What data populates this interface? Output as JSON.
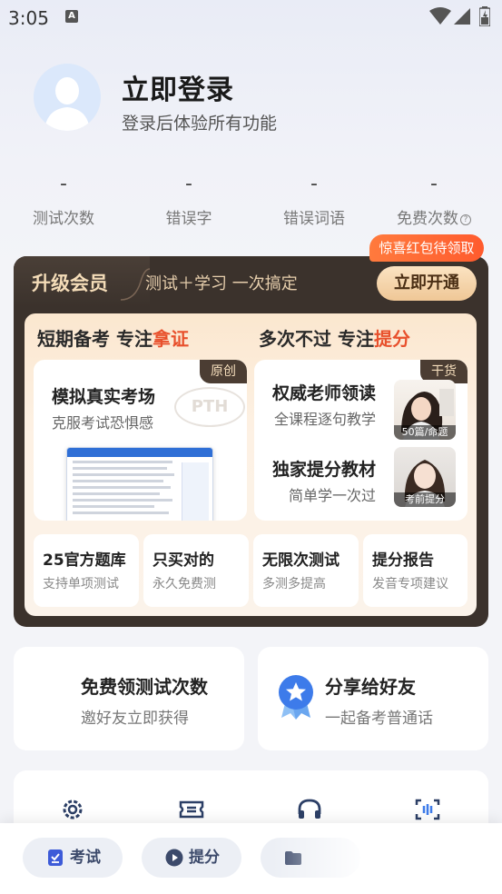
{
  "status_bar": {
    "time": "3:05",
    "notif_glyph": "A"
  },
  "profile": {
    "title": "立即登录",
    "subtitle": "登录后体验所有功能"
  },
  "stats": [
    {
      "value": "-",
      "label": "测试次数"
    },
    {
      "value": "-",
      "label": "错误字"
    },
    {
      "value": "-",
      "label": "错误词语"
    },
    {
      "value": "-",
      "label": "免费次数"
    }
  ],
  "vip": {
    "title": "升级会员",
    "slogan": "测试＋学习 一次搞定",
    "gift_badge": "惊喜红包待领取",
    "open_button": "立即开通",
    "left_heading": {
      "text": "短期备考 专注",
      "highlight": "拿证"
    },
    "right_heading": {
      "text": "多次不过 专注",
      "highlight": "提分"
    },
    "card_exam": {
      "tag": "原创",
      "title": "模拟真实考场",
      "subtitle": "克服考试恐惧感",
      "watermark": "PTH"
    },
    "card_teacher": {
      "tag": "干货",
      "title": "权威老师领读",
      "subtitle": "全课程逐句教学",
      "photo_caption": "50篇/命题"
    },
    "card_material": {
      "title": "独家提分教材",
      "subtitle": "简单学一次过",
      "photo_caption": "考前提分"
    },
    "minis": [
      {
        "title": "25官方题库",
        "subtitle": "支持单项测试"
      },
      {
        "title": "只买对的",
        "subtitle": "永久免费测"
      },
      {
        "title": "无限次测试",
        "subtitle": "多测多提高"
      },
      {
        "title": "提分报告",
        "subtitle": "发音专项建议"
      }
    ]
  },
  "promo": {
    "free_tests": {
      "title": "免费领测试次数",
      "subtitle": "邀好友立即获得"
    },
    "share": {
      "title": "分享给好友",
      "subtitle": "一起备考普通话"
    }
  },
  "tools": [
    {
      "icon": "gear-icon"
    },
    {
      "icon": "ticket-icon"
    },
    {
      "icon": "headset-icon"
    },
    {
      "icon": "voice-scan-icon"
    }
  ],
  "bottom_nav": [
    {
      "label": "考试",
      "icon": "exam-doc-icon"
    },
    {
      "label": "提分",
      "icon": "play-icon"
    },
    {
      "label": "",
      "icon": "folder-icon"
    }
  ],
  "colors": {
    "accent": "#e8502c",
    "nav_text": "#3c4a6b",
    "vip_dark": "#3b322c",
    "gold": "#efc796"
  }
}
